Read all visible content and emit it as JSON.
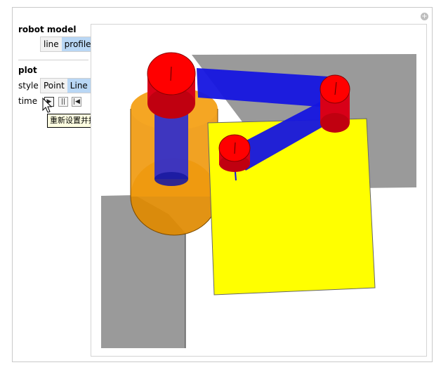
{
  "panel": {
    "robot_model_title": "robot model",
    "robot_model_options": [
      "line",
      "profile"
    ],
    "robot_model_selected": "profile",
    "plot_title": "plot",
    "style_label": "style",
    "style_options": [
      "Point",
      "Line"
    ],
    "style_selected": "Line",
    "time_label": "time",
    "controls": {
      "play": "▶",
      "pause": "||",
      "reset": "|◀"
    },
    "tooltip": "重新设置并播放"
  },
  "icons": {
    "corner": "plus-circle-icon",
    "play": "play-icon",
    "pause": "pause-icon",
    "reset": "reset-icon",
    "cursor": "arrow-cursor-icon"
  },
  "colors": {
    "link": "#0000ff",
    "joint": "#ff0000",
    "base": "#ff9900",
    "paper": "#ffff00",
    "ground": "#9a9a9a",
    "selected": "#b9d7f5"
  }
}
